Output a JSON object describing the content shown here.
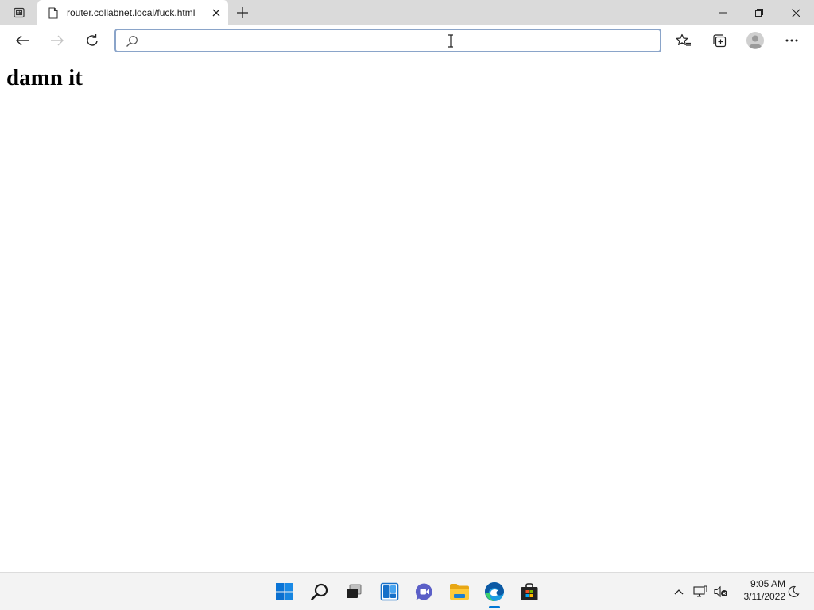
{
  "browser": {
    "tab": {
      "title": "router.collabnet.local/fuck.html"
    },
    "address_bar": {
      "value": "",
      "placeholder": ""
    },
    "accent_color": "#0078d4",
    "icons": {
      "tab_actions": "tab-actions-icon",
      "favicon": "page-icon",
      "tab_close": "close-icon",
      "new_tab": "plus-icon",
      "back": "arrow-left-icon",
      "forward": "arrow-right-icon",
      "refresh": "refresh-icon",
      "search": "search-icon",
      "favorites": "star-list-icon",
      "collections": "collections-icon",
      "profile": "profile-icon",
      "menu": "more-icon"
    },
    "forward_enabled": false
  },
  "page": {
    "heading": "damn it"
  },
  "taskbar": {
    "apps": [
      "start",
      "search",
      "task-view",
      "widgets",
      "chat",
      "file-explorer",
      "edge",
      "store"
    ],
    "active_app": "edge",
    "clock": {
      "time": "9:05 AM",
      "date": "3/11/2022"
    }
  }
}
